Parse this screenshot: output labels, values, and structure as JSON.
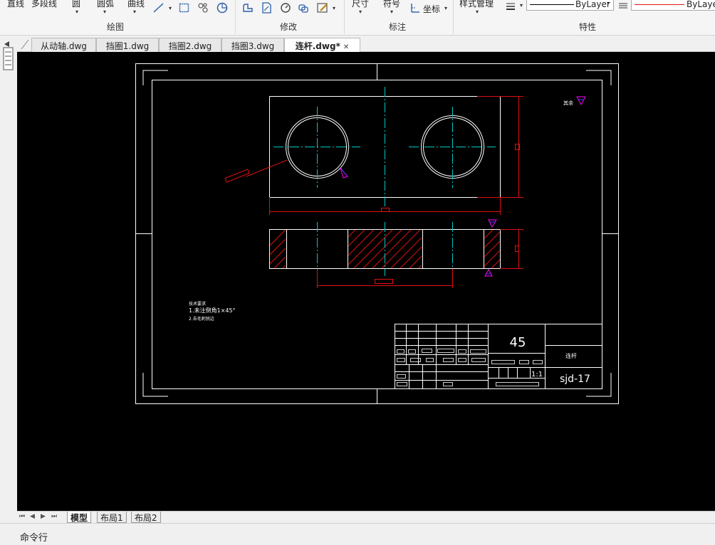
{
  "ribbon": {
    "draw_tools": {
      "line": "直线",
      "polyline": "多段线",
      "circle": "圆",
      "arc": "圆弧",
      "curve": "曲线"
    },
    "groups": {
      "draw": "绘图",
      "modify": "修改",
      "annotate": "标注",
      "properties": "特性"
    },
    "annotate_tools": {
      "dimension": "尺寸",
      "symbol": "符号",
      "coordinate": "坐标"
    },
    "properties": {
      "style_manager": "样式管理",
      "linetype_value": "ByLayer",
      "color_value": "ByLaye"
    }
  },
  "tabs": [
    {
      "label": "从动轴.dwg",
      "active": false
    },
    {
      "label": "挡圈1.dwg",
      "active": false
    },
    {
      "label": "挡圈2.dwg",
      "active": false
    },
    {
      "label": "挡圈3.dwg",
      "active": false
    },
    {
      "label": "连杆.dwg*",
      "active": true
    }
  ],
  "layout_tabs": [
    {
      "label": "模型",
      "active": true
    },
    {
      "label": "布局1",
      "active": false
    },
    {
      "label": "布局2",
      "active": false
    }
  ],
  "command_line": {
    "label": "命令行"
  },
  "drawing": {
    "title_material": "45",
    "title_part_name": "连杆",
    "title_drawing_code": "sjd-17",
    "title_scale": "1:1",
    "note_title": "技术要求",
    "note_line1": "1.未注倒角1×45°",
    "note_line2": "2.去毛刺锐边",
    "roughness_label": "其余"
  },
  "colors": {
    "ribbon_bg": "#f5f5f5",
    "canvas_bg": "#000000",
    "outline": "#ffffff",
    "centerline": "#00c8c8",
    "dimension": "#e01010",
    "symbol_magenta": "#ff00ff",
    "symbol_blue": "#4040ff"
  }
}
